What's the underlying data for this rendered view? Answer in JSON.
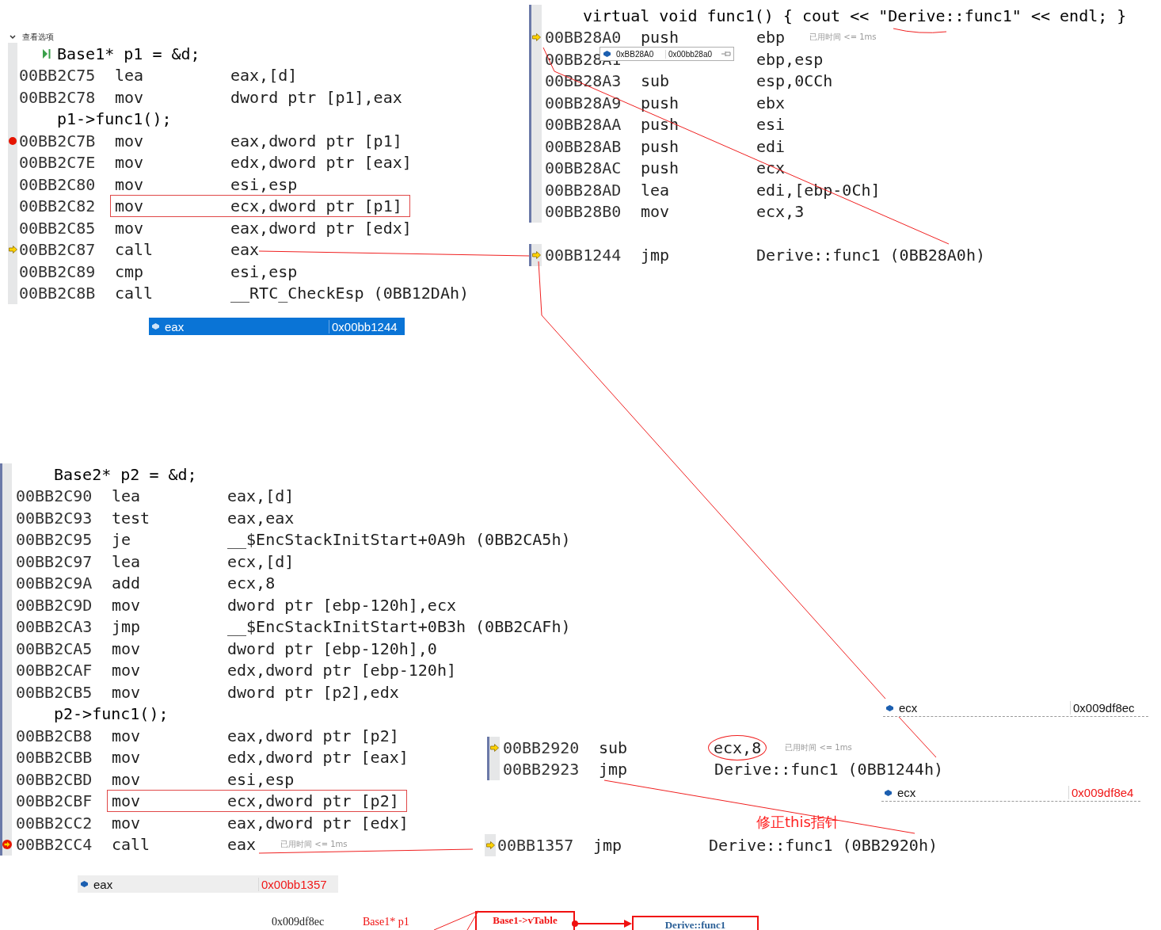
{
  "view_options": {
    "label": "查看选项",
    "expanded": true
  },
  "snippets": [
    {
      "rows": [
        {
          "kind": "source",
          "text": "Base1* p1 = &d;",
          "stepping": true
        },
        {
          "kind": "asm",
          "address": "00BB2C75",
          "mnemonic": "lea",
          "operand": "eax,[d]",
          "breakpoint": false,
          "current": false,
          "boxed": false
        },
        {
          "kind": "asm",
          "address": "00BB2C78",
          "mnemonic": "mov",
          "operand": "dword ptr [p1],eax",
          "breakpoint": false,
          "current": false,
          "boxed": false
        },
        {
          "kind": "source",
          "text": "p1->func1();",
          "stepping": false
        },
        {
          "kind": "asm",
          "address": "00BB2C7B",
          "mnemonic": "mov",
          "operand": "eax,dword ptr [p1]",
          "breakpoint": true,
          "current": false,
          "boxed": false
        },
        {
          "kind": "asm",
          "address": "00BB2C7E",
          "mnemonic": "mov",
          "operand": "edx,dword ptr [eax]",
          "breakpoint": false,
          "current": false,
          "boxed": false
        },
        {
          "kind": "asm",
          "address": "00BB2C80",
          "mnemonic": "mov",
          "operand": "esi,esp",
          "breakpoint": false,
          "current": false,
          "boxed": false
        },
        {
          "kind": "asm",
          "address": "00BB2C82",
          "mnemonic": "mov",
          "operand": "ecx,dword ptr [p1]",
          "breakpoint": false,
          "current": false,
          "boxed": true
        },
        {
          "kind": "asm",
          "address": "00BB2C85",
          "mnemonic": "mov",
          "operand": "eax,dword ptr [edx]",
          "breakpoint": false,
          "current": false,
          "boxed": false
        },
        {
          "kind": "asm",
          "address": "00BB2C87",
          "mnemonic": "call",
          "operand": "eax",
          "breakpoint": false,
          "current": true,
          "boxed": false
        },
        {
          "kind": "asm",
          "address": "00BB2C89",
          "mnemonic": "cmp",
          "operand": "esi,esp",
          "breakpoint": false,
          "current": false,
          "boxed": false
        },
        {
          "kind": "asm",
          "address": "00BB2C8B",
          "mnemonic": "call",
          "operand": "__RTC_CheckEsp (0BB12DAh)",
          "breakpoint": false,
          "current": false,
          "boxed": false
        }
      ]
    },
    {
      "rows": [
        {
          "kind": "source",
          "text": "virtual void func1() { cout << \"Derive::func1\" << endl; }",
          "stepping": false
        },
        {
          "kind": "asm",
          "address": "00BB28A0",
          "mnemonic": "push",
          "operand": "ebp",
          "hint": "已用时间 <= 1ms",
          "breakpoint": false,
          "current": true,
          "boxed": false
        },
        {
          "kind": "asm",
          "address": "00BB28A1",
          "operand": "ebp,esp",
          "breakpoint": false,
          "current": false,
          "boxed": false
        },
        {
          "kind": "asm",
          "address": "00BB28A3",
          "mnemonic": "sub",
          "operand": "esp,0CCh",
          "breakpoint": false,
          "current": false,
          "boxed": false
        },
        {
          "kind": "asm",
          "address": "00BB28A9",
          "mnemonic": "push",
          "operand": "ebx",
          "breakpoint": false,
          "current": false,
          "boxed": false
        },
        {
          "kind": "asm",
          "address": "00BB28AA",
          "mnemonic": "push",
          "operand": "esi",
          "breakpoint": false,
          "current": false,
          "boxed": false
        },
        {
          "kind": "asm",
          "address": "00BB28AB",
          "mnemonic": "push",
          "operand": "edi",
          "breakpoint": false,
          "current": false,
          "boxed": false
        },
        {
          "kind": "asm",
          "address": "00BB28AC",
          "mnemonic": "push",
          "operand": "ecx",
          "breakpoint": false,
          "current": false,
          "boxed": false
        },
        {
          "kind": "asm",
          "address": "00BB28AD",
          "mnemonic": "lea",
          "operand": "edi,[ebp-0Ch]",
          "breakpoint": false,
          "current": false,
          "boxed": false
        },
        {
          "kind": "asm",
          "address": "00BB28B0",
          "mnemonic": "mov",
          "operand": "ecx,3",
          "breakpoint": false,
          "current": false,
          "boxed": false
        }
      ]
    },
    {
      "rows": [
        {
          "kind": "asm",
          "address": "00BB1244",
          "mnemonic": "jmp",
          "operand": "Derive::func1 (0BB28A0h)",
          "breakpoint": false,
          "current": true,
          "boxed": false
        }
      ]
    },
    {
      "rows": [
        {
          "kind": "source",
          "text": "Base2* p2 = &d;",
          "stepping": false
        },
        {
          "kind": "asm",
          "address": "00BB2C90",
          "mnemonic": "lea",
          "operand": "eax,[d]",
          "breakpoint": false,
          "current": false,
          "boxed": false
        },
        {
          "kind": "asm",
          "address": "00BB2C93",
          "mnemonic": "test",
          "operand": "eax,eax",
          "breakpoint": false,
          "current": false,
          "boxed": false
        },
        {
          "kind": "asm",
          "address": "00BB2C95",
          "mnemonic": "je",
          "operand": "__$EncStackInitStart+0A9h (0BB2CA5h)",
          "breakpoint": false,
          "current": false,
          "boxed": false
        },
        {
          "kind": "asm",
          "address": "00BB2C97",
          "mnemonic": "lea",
          "operand": "ecx,[d]",
          "breakpoint": false,
          "current": false,
          "boxed": false
        },
        {
          "kind": "asm",
          "address": "00BB2C9A",
          "mnemonic": "add",
          "operand": "ecx,8",
          "breakpoint": false,
          "current": false,
          "boxed": false
        },
        {
          "kind": "asm",
          "address": "00BB2C9D",
          "mnemonic": "mov",
          "operand": "dword ptr [ebp-120h],ecx",
          "breakpoint": false,
          "current": false,
          "boxed": false
        },
        {
          "kind": "asm",
          "address": "00BB2CA3",
          "mnemonic": "jmp",
          "operand": "__$EncStackInitStart+0B3h (0BB2CAFh)",
          "breakpoint": false,
          "current": false,
          "boxed": false
        },
        {
          "kind": "asm",
          "address": "00BB2CA5",
          "mnemonic": "mov",
          "operand": "dword ptr [ebp-120h],0",
          "breakpoint": false,
          "current": false,
          "boxed": false
        },
        {
          "kind": "asm",
          "address": "00BB2CAF",
          "mnemonic": "mov",
          "operand": "edx,dword ptr [ebp-120h]",
          "breakpoint": false,
          "current": false,
          "boxed": false
        },
        {
          "kind": "asm",
          "address": "00BB2CB5",
          "mnemonic": "mov",
          "operand": "dword ptr [p2],edx",
          "breakpoint": false,
          "current": false,
          "boxed": false
        },
        {
          "kind": "source",
          "text": "p2->func1();",
          "stepping": false
        },
        {
          "kind": "asm",
          "address": "00BB2CB8",
          "mnemonic": "mov",
          "operand": "eax,dword ptr [p2]",
          "breakpoint": false,
          "current": false,
          "boxed": false
        },
        {
          "kind": "asm",
          "address": "00BB2CBB",
          "mnemonic": "mov",
          "operand": "edx,dword ptr [eax]",
          "breakpoint": false,
          "current": false,
          "boxed": false
        },
        {
          "kind": "asm",
          "address": "00BB2CBD",
          "mnemonic": "mov",
          "operand": "esi,esp",
          "breakpoint": false,
          "current": false,
          "boxed": false
        },
        {
          "kind": "asm",
          "address": "00BB2CBF",
          "mnemonic": "mov",
          "operand": "ecx,dword ptr [p2]",
          "breakpoint": false,
          "current": false,
          "boxed": true
        },
        {
          "kind": "asm",
          "address": "00BB2CC2",
          "mnemonic": "mov",
          "operand": "eax,dword ptr [edx]",
          "breakpoint": false,
          "current": false,
          "boxed": false
        },
        {
          "kind": "asm",
          "address": "00BB2CC4",
          "mnemonic": "call",
          "operand": "eax",
          "hint": "已用时间 <= 1ms",
          "breakpoint": true,
          "current": true,
          "boxed": false
        }
      ]
    },
    {
      "rows": [
        {
          "kind": "asm",
          "address": "00BB2920",
          "mnemonic": "sub",
          "operand": "ecx,8",
          "hint": "已用时间 <= 1ms",
          "breakpoint": false,
          "current": true,
          "boxed": false,
          "circled": true
        },
        {
          "kind": "asm",
          "address": "00BB2923",
          "mnemonic": "jmp",
          "operand": "Derive::func1 (0BB1244h)",
          "breakpoint": false,
          "current": false,
          "boxed": false
        }
      ]
    },
    {
      "rows": [
        {
          "kind": "asm",
          "address": "00BB1357",
          "mnemonic": "jmp",
          "operand": "Derive::func1 (0BB2920h)",
          "breakpoint": false,
          "current": true,
          "boxed": false
        }
      ]
    }
  ],
  "datatips": [
    {
      "kind": "selected",
      "name": "eax",
      "value": "0x00bb1244"
    },
    {
      "kind": "popup",
      "name": "0xBB28A0",
      "value": "0x00bb28a0"
    },
    {
      "kind": "watch",
      "name": "ecx",
      "value": "0x009df8ec",
      "changed": false
    },
    {
      "kind": "watch",
      "name": "ecx",
      "value": "0x009df8e4",
      "changed": true
    },
    {
      "kind": "shaded",
      "name": "eax",
      "value": "0x00bb1357",
      "changed": true
    }
  ],
  "annotation": {
    "note": "修正this指针"
  },
  "diagram": {
    "pointer_value": "0x009df8ec",
    "pointer_label": "Base1* p1",
    "vtable_label": "Base1->vTable",
    "target_label": "Derive::func1"
  }
}
